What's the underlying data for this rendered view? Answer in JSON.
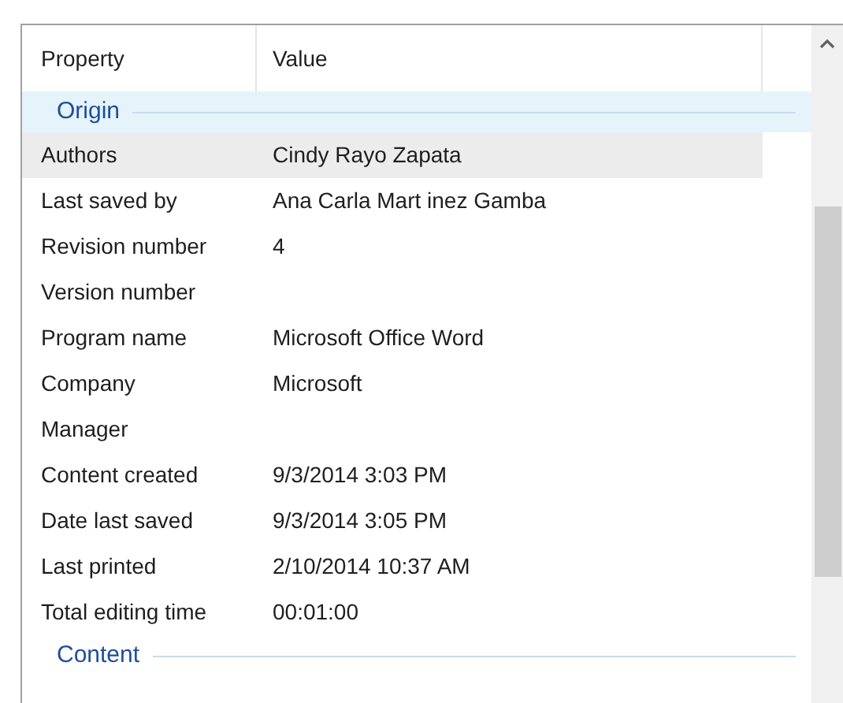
{
  "columns": [
    "Property",
    "Value"
  ],
  "groups": [
    {
      "label": "Origin",
      "rows": [
        {
          "property": "Authors",
          "value": "Cindy Rayo Zapata",
          "selected": true
        },
        {
          "property": "Last saved by",
          "value": "Ana Carla Mart inez Gamba",
          "selected": false
        },
        {
          "property": "Revision number",
          "value": "4",
          "selected": false
        },
        {
          "property": "Version number",
          "selected": false
        },
        {
          "property": "Program name",
          "value": "Microsoft Office Word",
          "selected": false
        },
        {
          "property": "Company",
          "value": "Microsoft",
          "selected": false
        },
        {
          "property": "Manager",
          "selected": false
        },
        {
          "property": "Content created",
          "value": "9/3/2014 3:03 PM",
          "selected": false
        },
        {
          "property": "Date last saved",
          "value": "9/3/2014 3:05 PM",
          "selected": false
        },
        {
          "property": "Last printed",
          "value": "2/10/2014 10:37 AM",
          "selected": false
        },
        {
          "property": "Total editing time",
          "value": "00:01:00",
          "selected": false
        }
      ]
    },
    {
      "label": "Content"
    }
  ]
}
